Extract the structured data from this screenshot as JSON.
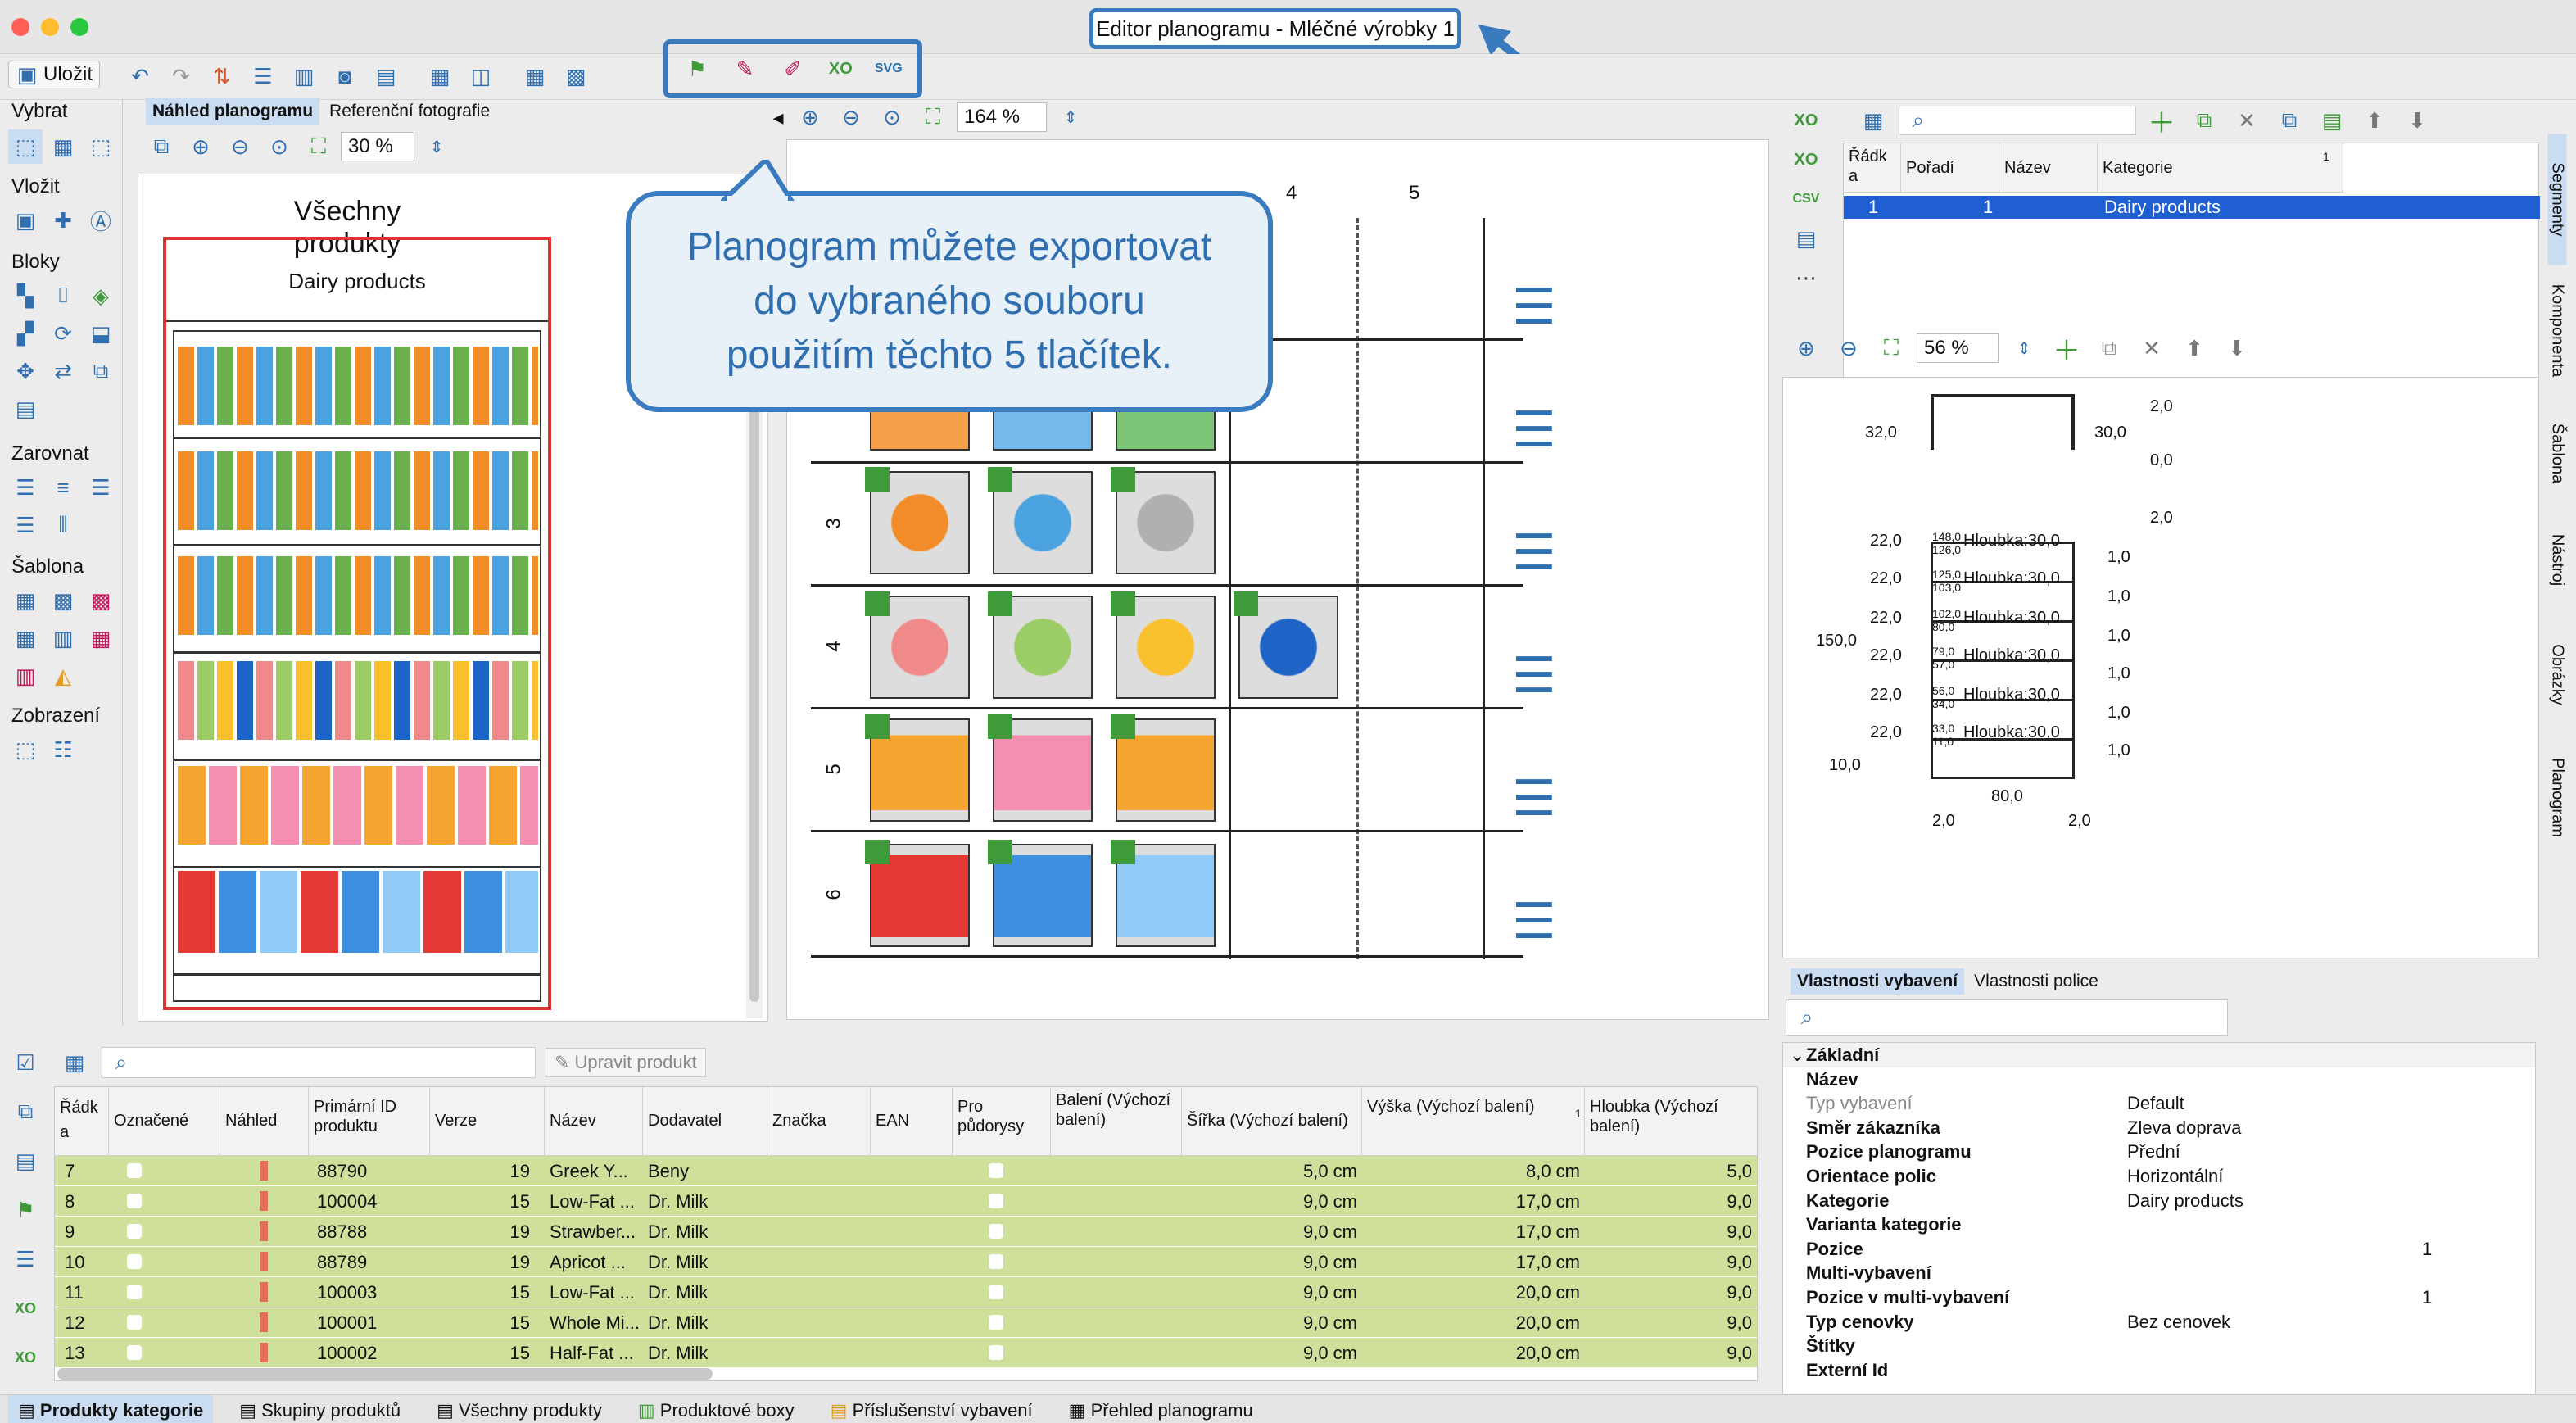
{
  "window": {
    "title": "Editor planogramu - Mléčné výrobky 1"
  },
  "toolbar": {
    "save_label": "Uložit"
  },
  "left_tools": {
    "sections": [
      "Vybrat",
      "Vložit",
      "Bloky",
      "Zarovnat",
      "Šablona",
      "Zobrazení"
    ]
  },
  "preview": {
    "tabs": [
      "Náhled planogramu",
      "Referenční fotografie"
    ],
    "zoom": "30 %",
    "title": "Všechny produkty",
    "category": "Dairy products"
  },
  "main_view": {
    "zoom": "164 %",
    "columns": [
      "4",
      "5"
    ],
    "rows": [
      "3",
      "4",
      "5",
      "6"
    ]
  },
  "callout": {
    "line1": "Planogram můžete exportovat",
    "line2": "do vybraného souboru",
    "line3": "použitím těchto 5 tlačítek."
  },
  "segments": {
    "headers": [
      "Řádk a",
      "Pořadí",
      "Název",
      "Kategorie"
    ],
    "sort_index": "1",
    "row": {
      "radka": "1",
      "poradi": "1",
      "nazev": "",
      "kategorie": "Dairy products"
    }
  },
  "drawing": {
    "zoom": "56 %",
    "dims": {
      "top_left": "32,0",
      "top_right_a": "2,0",
      "top_right_b": "30,0",
      "top_right_c": "0,0",
      "side": "2,0",
      "left_total": "150,0",
      "bottom_left": "10,0",
      "bottom_mid": "80,0",
      "bottom_l": "2,0",
      "bottom_r": "2,0"
    },
    "shelves": [
      {
        "w": "22,0",
        "a": "148,0",
        "b": "126,0",
        "d": "Hloubka:30,0",
        "r": "1,0"
      },
      {
        "w": "22,0",
        "a": "125,0",
        "b": "103,0",
        "d": "Hloubka:30,0",
        "r": "1,0"
      },
      {
        "w": "22,0",
        "a": "102,0",
        "b": "80,0",
        "d": "Hloubka:30,0",
        "r": "1,0"
      },
      {
        "w": "22,0",
        "a": "79,0",
        "b": "57,0",
        "d": "Hloubka:30,0",
        "r": "1,0"
      },
      {
        "w": "22,0",
        "a": "56,0",
        "b": "34,0",
        "d": "Hloubka:30,0",
        "r": "1,0"
      },
      {
        "w": "22,0",
        "a": "33,0",
        "b": "11,0",
        "d": "Hloubka:30,0",
        "r": "1,0"
      }
    ]
  },
  "props": {
    "tabs": [
      "Vlastnosti vybavení",
      "Vlastnosti police"
    ],
    "group": "Základní",
    "items": [
      {
        "n": "Název",
        "v": ""
      },
      {
        "n": "Typ vybavení",
        "v": "Default"
      },
      {
        "n": "Směr zákazníka",
        "v": "Zleva doprava"
      },
      {
        "n": "Pozice planogramu",
        "v": "Přední"
      },
      {
        "n": "Orientace polic",
        "v": "Horizontální"
      },
      {
        "n": "Kategorie",
        "v": "Dairy products"
      },
      {
        "n": "Varianta kategorie",
        "v": ""
      },
      {
        "n": "Pozice",
        "v": "1"
      },
      {
        "n": "Multi-vybavení",
        "v": ""
      },
      {
        "n": "Pozice v multi-vybavení",
        "v": "1"
      },
      {
        "n": "Typ cenovky",
        "v": "Bez cenovek"
      },
      {
        "n": "Štítky",
        "v": ""
      },
      {
        "n": "Externí Id",
        "v": ""
      }
    ]
  },
  "right_tabs": [
    "Segmenty",
    "Komponenta",
    "Šablona",
    "Nástroj",
    "Obrázky",
    "Planogram"
  ],
  "products": {
    "edit_label": "Upravit produkt",
    "headers": [
      "Řádk a",
      "Označené",
      "Náhled",
      "Primární ID produktu",
      "Verze",
      "Název",
      "Dodavatel",
      "Značka",
      "EAN",
      "Pro půdorysy",
      "Balení (Výchozí balení)",
      "Šířka (Výchozí balení)",
      "Výška (Výchozí balení)",
      "Hloubka (Výchozí balení)"
    ],
    "sort_index": "1",
    "rows": [
      {
        "r": "7",
        "id": "88790",
        "ver": "19",
        "name": "Greek Y...",
        "sup": "Beny",
        "w": "5,0 cm",
        "h": "8,0 cm",
        "d": "5,0"
      },
      {
        "r": "8",
        "id": "100004",
        "ver": "15",
        "name": "Low-Fat ...",
        "sup": "Dr. Milk",
        "w": "9,0 cm",
        "h": "17,0 cm",
        "d": "9,0"
      },
      {
        "r": "9",
        "id": "88788",
        "ver": "19",
        "name": "Strawber...",
        "sup": "Dr. Milk",
        "w": "9,0 cm",
        "h": "17,0 cm",
        "d": "9,0"
      },
      {
        "r": "10",
        "id": "88789",
        "ver": "19",
        "name": "Apricot ...",
        "sup": "Dr. Milk",
        "w": "9,0 cm",
        "h": "17,0 cm",
        "d": "9,0"
      },
      {
        "r": "11",
        "id": "100003",
        "ver": "15",
        "name": "Low-Fat ...",
        "sup": "Dr. Milk",
        "w": "9,0 cm",
        "h": "20,0 cm",
        "d": "9,0"
      },
      {
        "r": "12",
        "id": "100001",
        "ver": "15",
        "name": "Whole Mi...",
        "sup": "Dr. Milk",
        "w": "9,0 cm",
        "h": "20,0 cm",
        "d": "9,0"
      },
      {
        "r": "13",
        "id": "100002",
        "ver": "15",
        "name": "Half-Fat ...",
        "sup": "Dr. Milk",
        "w": "9,0 cm",
        "h": "20,0 cm",
        "d": "9,0"
      }
    ]
  },
  "bottom_tabs": [
    "Produkty kategorie",
    "Skupiny produktů",
    "Všechny produkty",
    "Produktové boxy",
    "Příslušenství vybavení",
    "Přehled planogramu"
  ],
  "colors": {
    "accent": "#3a7bbf",
    "row_green": "#cfe09a",
    "selected": "#1f5fd1"
  }
}
